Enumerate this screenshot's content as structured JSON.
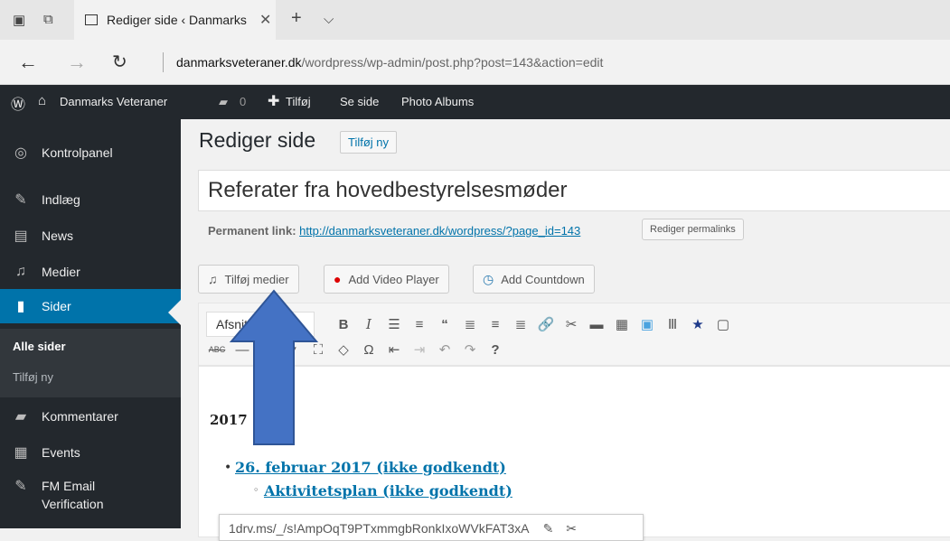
{
  "browser": {
    "tab_title": "Rediger side ‹ Danmarks",
    "url_domain": "danmarksveteraner.dk",
    "url_path": "/wordpress/wp-admin/post.php?post=143&action=edit"
  },
  "adminbar": {
    "site_name": "Danmarks Veteraner",
    "comments_count": "0",
    "add_new": "Tilføj",
    "view_page": "Se side",
    "photo_albums": "Photo Albums"
  },
  "sidebar": {
    "items": [
      {
        "label": "Kontrolpanel",
        "icon": "dashboard-icon"
      },
      {
        "label": "Indlæg",
        "icon": "pin-icon"
      },
      {
        "label": "News",
        "icon": "document-icon"
      },
      {
        "label": "Medier",
        "icon": "media-icon"
      },
      {
        "label": "Sider",
        "icon": "pages-icon"
      },
      {
        "label": "Kommentarer",
        "icon": "comment-icon"
      },
      {
        "label": "Events",
        "icon": "calendar-icon"
      },
      {
        "label": "FM Email",
        "label2": "Verification",
        "icon": "pin-icon"
      }
    ],
    "sub": {
      "all_pages": "Alle sider",
      "add_new": "Tilføj ny"
    }
  },
  "main": {
    "page_title": "Rediger side",
    "add_new_button": "Tilføj ny",
    "post_title": "Referater fra hovedbestyrelsesmøder",
    "permalink_label": "Permanent link:",
    "permalink_url": "http://danmarksveteraner.dk/wordpress/?page_id=143",
    "edit_permalinks": "Rediger permalinks",
    "add_media": "Tilføj medier",
    "add_video_player": "Add Video Player",
    "add_countdown": "Add Countdown",
    "format_select": "Afsnit",
    "content": {
      "year": "2017",
      "link1": "26. februar 2017 (ikke godkendt)",
      "link2": "Aktivitetsplan (ikke godkendt)",
      "popup_url": "1drv.ms/_/s!AmpOqT9PTxmmgbRonkIxoWVkFAT3xA"
    }
  },
  "colors": {
    "admin_dark": "#23282d",
    "accent": "#0073aa",
    "arrow": "#4472c4"
  }
}
